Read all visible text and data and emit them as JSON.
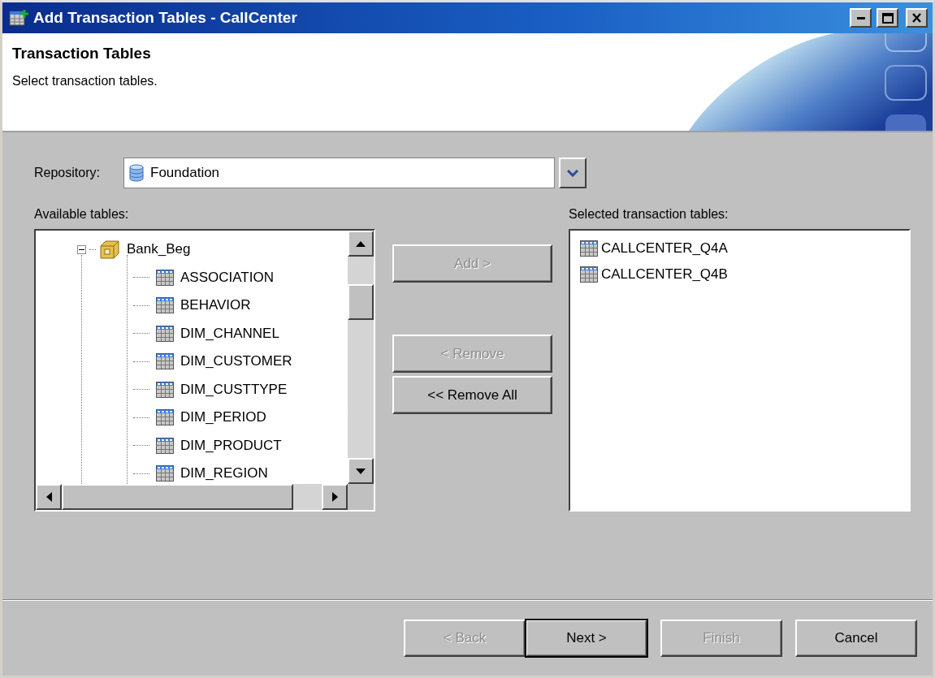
{
  "window": {
    "title": "Add Transaction Tables - CallCenter"
  },
  "header": {
    "title": "Transaction Tables",
    "subtitle": "Select transaction tables."
  },
  "repository": {
    "label": "Repository:",
    "value": "Foundation"
  },
  "available": {
    "label": "Available tables:",
    "tree": [
      {
        "label": "Bank_Beg",
        "expanded": true,
        "children": [
          {
            "label": "ASSOCIATION"
          },
          {
            "label": "BEHAVIOR"
          },
          {
            "label": "DIM_CHANNEL"
          },
          {
            "label": "DIM_CUSTOMER"
          },
          {
            "label": "DIM_CUSTTYPE"
          },
          {
            "label": "DIM_PERIOD"
          },
          {
            "label": "DIM_PRODUCT"
          },
          {
            "label": "DIM_REGION"
          }
        ]
      }
    ]
  },
  "actions": [
    {
      "label": "Add >",
      "disabled": true
    },
    {
      "label": "< Remove",
      "disabled": true
    },
    {
      "label": "<< Remove All",
      "disabled": false
    }
  ],
  "selected": {
    "label": "Selected transaction tables:",
    "items": [
      {
        "label": "CALLCENTER_Q4A"
      },
      {
        "label": "CALLCENTER_Q4B"
      }
    ]
  },
  "footer": [
    {
      "label": "< Back",
      "disabled": true,
      "default": false
    },
    {
      "label": "Next >",
      "disabled": false,
      "default": true
    },
    {
      "label": "Finish",
      "disabled": true,
      "default": false
    },
    {
      "label": "Cancel",
      "disabled": false,
      "default": false
    }
  ]
}
